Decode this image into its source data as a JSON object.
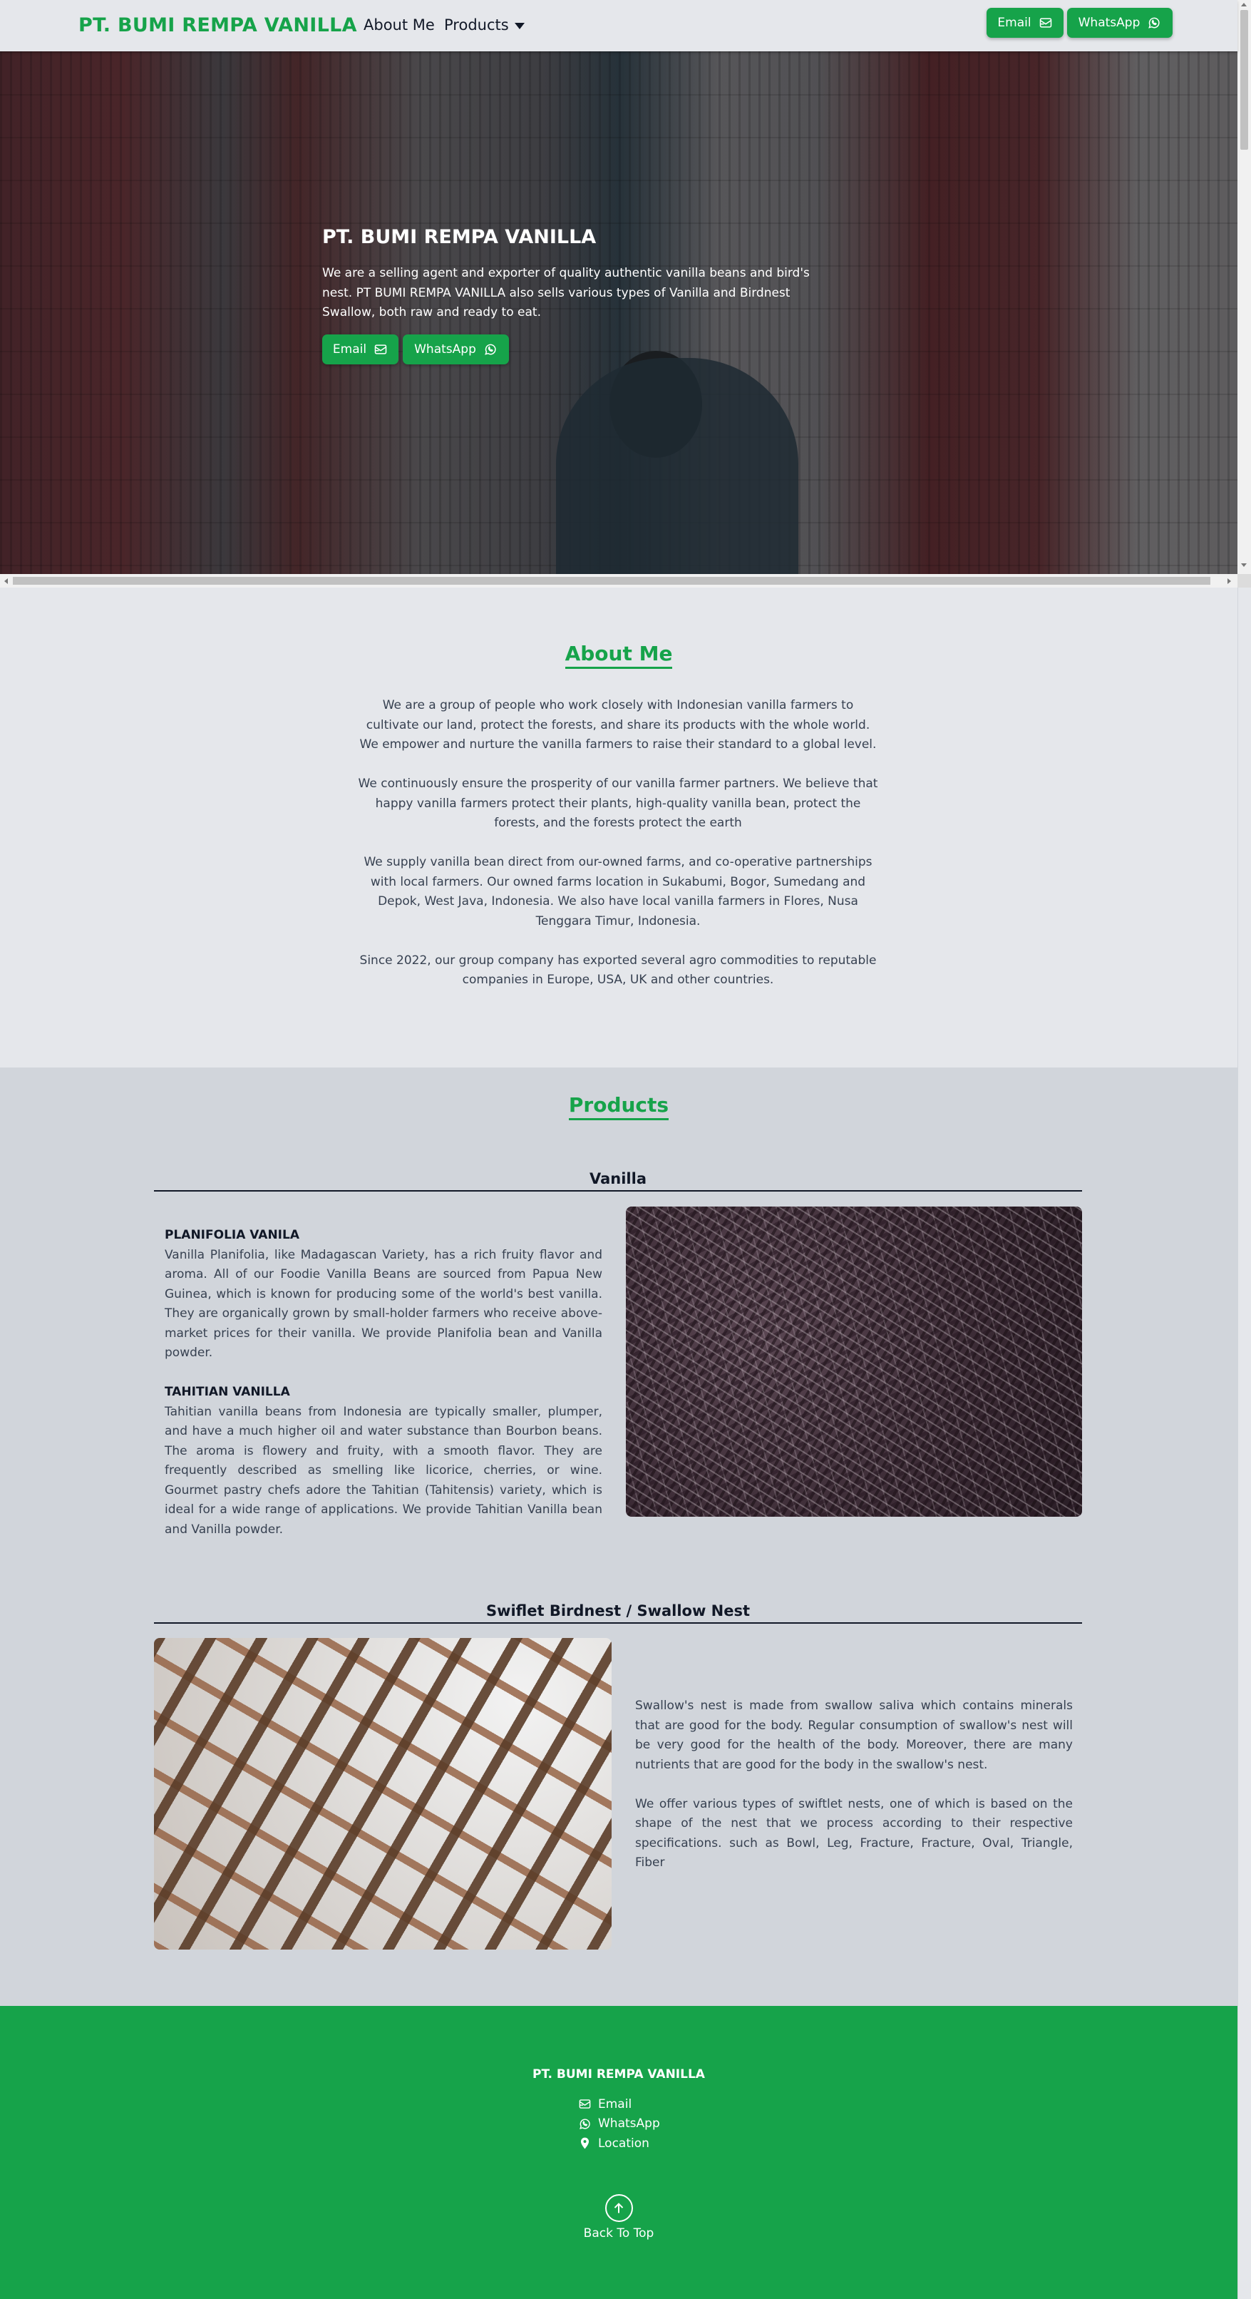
{
  "brand": "PT. BUMI REMPA VANILLA",
  "nav": {
    "about": "About Me",
    "products": "Products",
    "email": "Email",
    "whatsapp": "WhatsApp"
  },
  "hero": {
    "title": "PT. BUMI REMPA VANILLA",
    "description": "We are a selling agent and exporter of quality authentic vanilla beans and bird's nest. PT BUMI REMPA VANILLA also sells various types of Vanilla and Birdnest Swallow, both raw and ready to eat.",
    "email": "Email",
    "whatsapp": "WhatsApp"
  },
  "about": {
    "title": "About Me",
    "paragraphs": [
      "We are a group of people who work closely with Indonesian vanilla farmers to cultivate our land, protect the forests, and share its products with the whole world. We empower and nurture the vanilla farmers to raise their standard to a global level.",
      "We continuously ensure the prosperity of our vanilla farmer partners. We believe that happy vanilla farmers protect their plants, high-quality vanilla bean, protect the forests, and the forests protect the earth",
      "We supply vanilla bean direct from our-owned farms, and co-operative partnerships with local farmers. Our owned farms location in Sukabumi, Bogor, Sumedang and Depok, West Java, Indonesia. We also have local vanilla farmers in Flores, Nusa Tenggara Timur, Indonesia.",
      "Since 2022, our group company has exported several agro commodities to reputable companies in Europe, USA, UK and other countries."
    ]
  },
  "products": {
    "title": "Products",
    "vanilla": {
      "title": "Vanilla",
      "items": [
        {
          "name": "PLANIFOLIA VANILA",
          "description": "Vanilla Planifolia, like Madagascan Variety, has a rich fruity flavor and aroma. All of our Foodie Vanilla Beans are sourced from Papua New Guinea, which is known for producing some of the world's best vanilla. They are organically grown by small-holder farmers who receive above-market prices for their vanilla. We provide Planifolia bean and Vanilla powder."
        },
        {
          "name": "TAHITIAN VANILLA",
          "description": "Tahitian vanilla beans from Indonesia are typically smaller, plumper, and have a much higher oil and water substance than Bourbon beans. The aroma is flowery and fruity, with a smooth flavor. They are frequently described as smelling like licorice, cherries, or wine. Gourmet pastry chefs adore the Tahitian (Tahitensis) variety, which is ideal for a wide range of applications. We provide Tahitian Vanilla bean and Vanilla powder."
        }
      ]
    },
    "nest": {
      "title": "Swiflet Birdnest / Swallow Nest",
      "paragraphs": [
        "Swallow's nest is made from swallow saliva which contains minerals that are good for the body. Regular consumption of swallow's nest will be very good for the health of the body. Moreover, there are many nutrients that are good for the body in the swallow's nest.",
        "We offer various types of swiftlet nests, one of which is based on the shape of the nest that we process according to their respective specifications. such as Bowl, Leg, Fracture, Fracture, Oval, Triangle, Fiber"
      ]
    }
  },
  "footer": {
    "brand": "PT. BUMI REMPA VANILLA",
    "links": {
      "email": "Email",
      "whatsapp": "WhatsApp",
      "location": "Location"
    },
    "back_to_top": "Back To Top"
  },
  "colors": {
    "accent": "#16a34a",
    "background": "#e5e7eb",
    "products_background": "#d1d5db"
  },
  "icons": {
    "email": "envelope-icon",
    "whatsapp": "whatsapp-icon",
    "location": "map-pin-icon",
    "back_to_top": "arrow-up-circle-icon",
    "products_menu": "caret-down-icon"
  }
}
